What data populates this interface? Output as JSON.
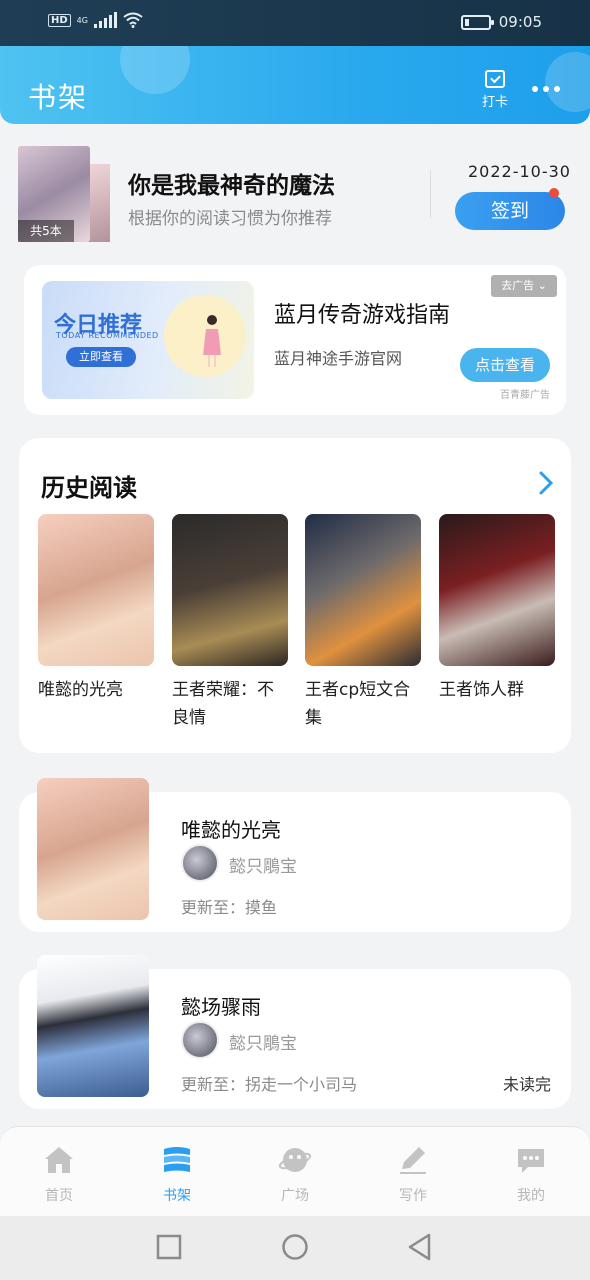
{
  "status_bar": {
    "hd": "HD",
    "network": "4G",
    "time": "09:05",
    "battery_level": 0.2
  },
  "header": {
    "title": "书架",
    "checkin_label": "打卡"
  },
  "top_book": {
    "count_badge": "共5本",
    "title": "你是我最神奇的魔法",
    "subtitle": "根据你的阅读习惯为你推荐",
    "date": "2022-10-30",
    "signin_label": "签到"
  },
  "ad": {
    "image_title": "今日推荐",
    "image_subtitle": "TODAY RECOMMENDED",
    "image_button": "立即查看",
    "title": "蓝月传奇游戏指南",
    "subtitle": "蓝月神途手游官网",
    "close_label": "去广告",
    "action_label": "点击查看",
    "source_label": "百青藤广告"
  },
  "history": {
    "title": "历史阅读",
    "items": [
      {
        "name": "唯懿的光亮"
      },
      {
        "name": "王者荣耀：不良情"
      },
      {
        "name": "王者cp短文合集"
      },
      {
        "name": "王者饰人群"
      }
    ]
  },
  "shelf": [
    {
      "title": "唯懿的光亮",
      "author": "懿只鵰宝",
      "update_prefix": "更新至：",
      "update": "摸鱼",
      "status": ""
    },
    {
      "title": "懿场骤雨",
      "author": "懿只鵰宝",
      "update_prefix": "更新至：",
      "update": "拐走一个小司马",
      "status": "未读完"
    }
  ],
  "bottom_nav": {
    "items": [
      {
        "label": "首页",
        "icon": "home-icon"
      },
      {
        "label": "书架",
        "icon": "bookshelf-icon"
      },
      {
        "label": "广场",
        "icon": "planet-icon"
      },
      {
        "label": "写作",
        "icon": "pencil-icon"
      },
      {
        "label": "我的",
        "icon": "chat-bubble-icon"
      }
    ],
    "active_index": 1
  },
  "colors": {
    "accent": "#2c9ef0",
    "header_start": "#4fc3f1",
    "header_end": "#1e9fea",
    "badge_red": "#f04a3a"
  }
}
